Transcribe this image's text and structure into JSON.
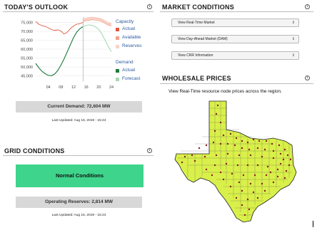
{
  "outlook": {
    "title": "TODAY'S OUTLOOK",
    "y_ticks": [
      "75,000",
      "70,000",
      "65,000",
      "60,000",
      "55,000",
      "50,000",
      "45,000"
    ],
    "x_ticks": [
      "04",
      "08",
      "12",
      "16",
      "20",
      "24"
    ],
    "legend": {
      "capacity_heading": "Capacity",
      "capacity_actual": "Actual",
      "capacity_available": "Available",
      "capacity_reserves": "Reserves",
      "demand_heading": "Demand",
      "demand_actual": "Actual",
      "demand_forecast": "Forecast"
    },
    "colors": {
      "capacity_actual": "#e2583e",
      "capacity_available": "#f2a08a",
      "capacity_reserves": "#f8d3c8",
      "demand_actual": "#1e7a3c",
      "demand_forecast": "#a8d8b2"
    },
    "current_demand": "Current Demand: 72,604 MW",
    "last_updated": "Last Updated: Aug 16, 2019 - 15:24"
  },
  "market": {
    "title": "MARKET CONDITIONS",
    "selects": [
      "View Real-Time Market",
      "View Day-Ahead Market (DAM)",
      "View CRR Information"
    ]
  },
  "wholesale": {
    "title": "WHOLESALE PRICES",
    "caption": "View Real-Time resource node prices across the region.",
    "map_fill": "#d9f04a",
    "dot_color": "#8b1a1a"
  },
  "grid": {
    "title": "GRID CONDITIONS",
    "status": "Normal Conditions",
    "status_color": "#3fd48b",
    "operating_reserves": "Operating Reserves: 2,814 MW",
    "last_updated": "Last Updated: Aug 16, 2019 - 15:24"
  },
  "chart_data": {
    "type": "line",
    "title": "",
    "x_range": [
      0,
      24
    ],
    "ylim": [
      42000,
      78000
    ],
    "series": [
      {
        "name": "Capacity Actual",
        "x": [
          0,
          1,
          2,
          3,
          4,
          5,
          6,
          7,
          8,
          9,
          10,
          11,
          12,
          13,
          14,
          15
        ],
        "values": [
          75500,
          74000,
          73200,
          72800,
          72000,
          71000,
          70500,
          70800,
          70200,
          68500,
          69500,
          71500,
          73000,
          74000,
          74300,
          75000
        ]
      },
      {
        "name": "Capacity Available",
        "x": [
          15,
          16,
          17,
          18,
          19,
          20,
          21,
          22,
          23,
          24
        ],
        "values": [
          75500,
          76000,
          76200,
          76500,
          76300,
          76000,
          75500,
          74500,
          73500,
          73000
        ]
      },
      {
        "name": "Capacity Reserves",
        "x": [
          15,
          16,
          17,
          18,
          19,
          20,
          21,
          22,
          23,
          24
        ],
        "values": [
          77000,
          77500,
          77800,
          78000,
          77800,
          77500,
          77000,
          76000,
          75000,
          74500
        ]
      },
      {
        "name": "Demand Actual",
        "x": [
          0,
          1,
          2,
          3,
          4,
          5,
          6,
          7,
          8,
          9,
          10,
          11,
          12,
          13,
          14,
          15
        ],
        "values": [
          52000,
          49500,
          47500,
          46200,
          45300,
          45100,
          46000,
          48000,
          51000,
          54500,
          58500,
          62500,
          66500,
          69500,
          71500,
          72600
        ]
      },
      {
        "name": "Demand Forecast",
        "x": [
          15,
          16,
          17,
          18,
          19,
          20,
          21,
          22,
          23,
          24
        ],
        "values": [
          72600,
          73300,
          73600,
          73300,
          72500,
          71000,
          68500,
          65000,
          61500,
          58500
        ]
      }
    ]
  }
}
